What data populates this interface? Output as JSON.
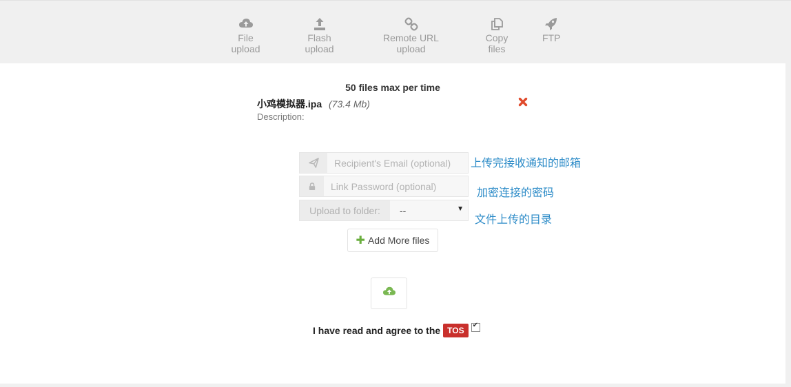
{
  "tabs": [
    {
      "label": "File upload",
      "icon": "cloud-upload-icon"
    },
    {
      "label": "Flash upload",
      "icon": "upload-icon"
    },
    {
      "label": "Remote URL upload",
      "icon": "link-icon"
    },
    {
      "label": "Copy files",
      "icon": "copy-icon"
    },
    {
      "label": "FTP",
      "icon": "rocket-icon"
    }
  ],
  "upload": {
    "max_files_text": "50 files max per time",
    "file": {
      "name": "小鸡模拟器.ipa",
      "size": "(73.4 Mb)"
    },
    "description_label": "Description:"
  },
  "form": {
    "email_placeholder": "Recipient's Email (optional)",
    "password_placeholder": "Link Password (optional)",
    "folder_label": "Upload to folder:",
    "folder_value": "--",
    "add_more_label": "Add More files"
  },
  "notes": {
    "email": "上传完接收通知的邮箱",
    "password": "加密连接的密码",
    "folder": "文件上传的目录"
  },
  "tos": {
    "text": "I have read and agree to the",
    "badge": "TOS",
    "checked": true
  },
  "colors": {
    "note_blue": "#2e8cc8",
    "tos_red": "#c9302c",
    "add_green": "#6aae3e",
    "remove_red": "#e04a2b"
  }
}
